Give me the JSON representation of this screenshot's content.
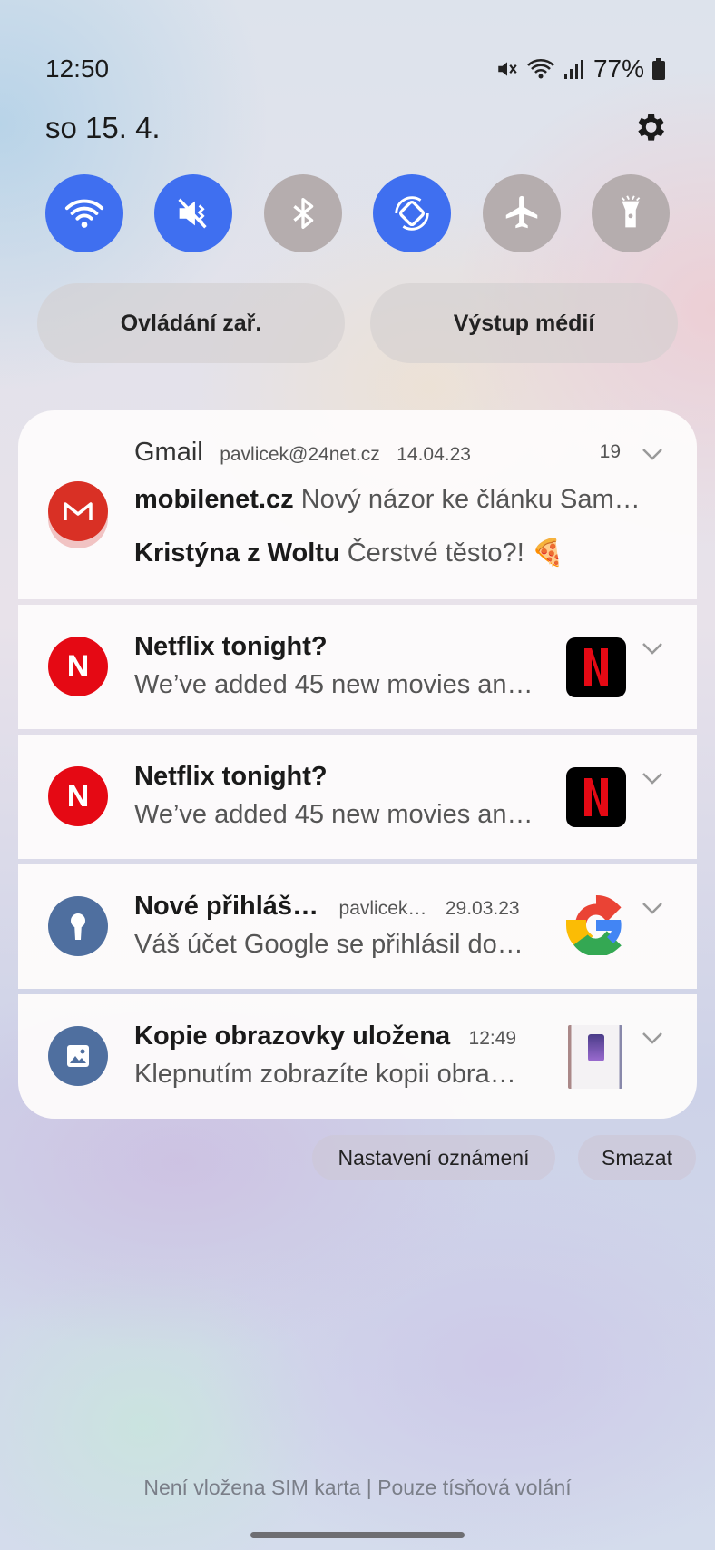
{
  "status": {
    "time": "12:50",
    "battery": "77%"
  },
  "header": {
    "date": "so 15. 4."
  },
  "quick_settings": [
    {
      "name": "wifi",
      "state": "on"
    },
    {
      "name": "mute",
      "state": "on"
    },
    {
      "name": "bluetooth",
      "state": "off"
    },
    {
      "name": "auto-rotate",
      "state": "on"
    },
    {
      "name": "airplane",
      "state": "off"
    },
    {
      "name": "flashlight",
      "state": "off"
    }
  ],
  "pills": {
    "device_control": "Ovládání zař.",
    "media_output": "Výstup médií"
  },
  "notifications": {
    "gmail": {
      "app": "Gmail",
      "account": "pavlicek@24net.cz",
      "date": "14.04.23",
      "count": "19",
      "line1_sender": "mobilenet.cz",
      "line1_text": "Nový názor ke článku Sam…",
      "line2_sender": "Kristýna z Woltu",
      "line2_text": "Čerstvé těsto?! 🍕",
      "accent": "#d93025"
    },
    "netflix1": {
      "title": "Netflix tonight?",
      "text": "We’ve added 45 new movies an…",
      "accent": "#e50914"
    },
    "netflix2": {
      "title": "Netflix tonight?",
      "text": "We’ve added 45 new movies an…",
      "accent": "#e50914"
    },
    "google": {
      "title": "Nové přihláš…",
      "account": "pavlicek…",
      "date": "29.03.23",
      "text": "Váš účet Google se přihlásil do…",
      "accent": "#4f6f9f"
    },
    "screenshot": {
      "title": "Kopie obrazovky uložena",
      "time": "12:49",
      "text": "Klepnutím zobrazíte kopii obra…",
      "accent": "#4f6f9f"
    }
  },
  "actions": {
    "settings": "Nastavení oznámení",
    "clear": "Smazat"
  },
  "footer": "Není vložena SIM karta | Pouze tísňová volání"
}
